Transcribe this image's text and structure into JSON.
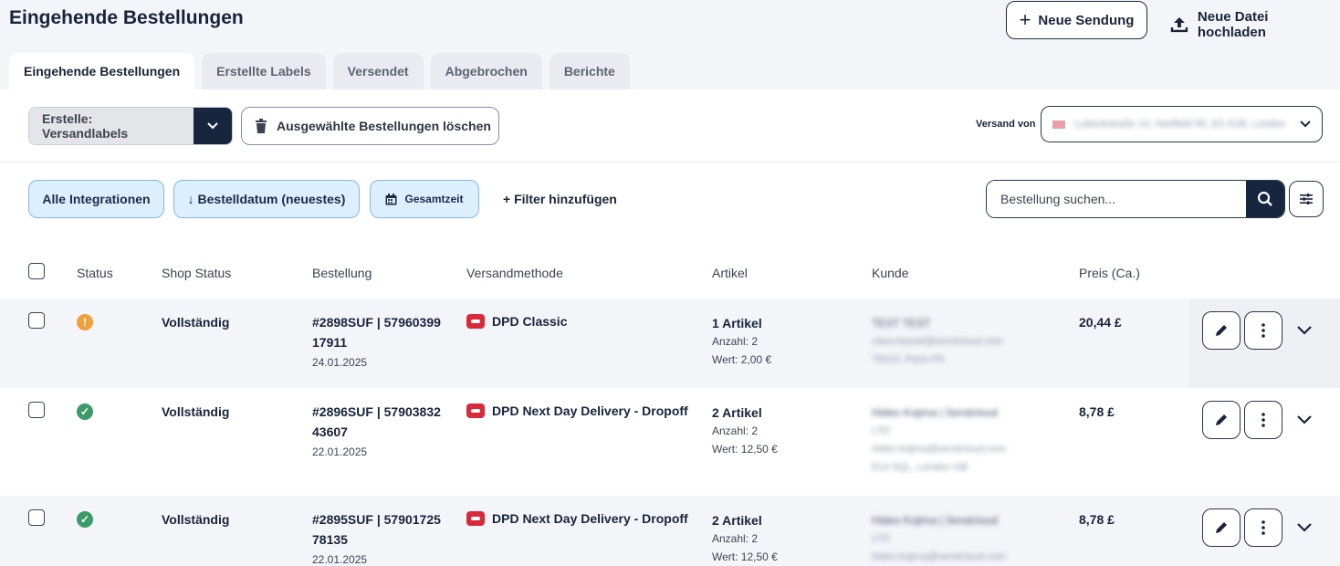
{
  "header": {
    "title": "Eingehende Bestellungen",
    "new_shipment_label": "Neue Sendung",
    "upload_label": "Neue Datei hochladen"
  },
  "tabs": [
    {
      "label": "Eingehende Bestellungen",
      "active": true
    },
    {
      "label": "Erstellte Labels",
      "active": false
    },
    {
      "label": "Versendet",
      "active": false
    },
    {
      "label": "Abgebrochen",
      "active": false
    },
    {
      "label": "Berichte",
      "active": false
    }
  ],
  "toolbar": {
    "create_label": "Erstelle: Versandlabels",
    "delete_label": "Ausgewählte Bestellungen löschen",
    "ship_from_label": "Versand von",
    "ship_from_value": "Lubeckstraße 14, Hartfield 95, E9 2UB, London"
  },
  "filters": {
    "integrations": "Alle Integrationen",
    "sort": "↓ Bestelldatum (neuestes)",
    "period": "Gesamtzeit",
    "add_filter": "+ Filter hinzufügen",
    "search_placeholder": "Bestellung suchen..."
  },
  "columns": [
    "Status",
    "Shop Status",
    "Bestellung",
    "Versandmethode",
    "Artikel",
    "Kunde",
    "Preis (Ca.)"
  ],
  "orders": [
    {
      "status": "warning",
      "status_color": "#f0a03c",
      "shop_status": "Vollständig",
      "order_line1": "#2898SUF | 57960399",
      "order_line2": "17911",
      "date": "24.01.2025",
      "method": "DPD Classic",
      "items": "1 Artikel",
      "qty": "Anzahl: 2",
      "value": "Wert: 2,00 €",
      "customer_name": "TEST TEST",
      "customer_line2": "clara.hessel@sendcloud.com",
      "customer_line3": "75015, Paris FR",
      "price": "20,44 £"
    },
    {
      "status": "ok",
      "status_color": "#3a9a6a",
      "shop_status": "Vollständig",
      "order_line1": "#2896SUF | 57903832",
      "order_line2": "43607",
      "date": "22.01.2025",
      "method": "DPD Next Day Delivery - Dropoff",
      "items": "2 Artikel",
      "qty": "Anzahl: 2",
      "value": "Wert: 12,50 €",
      "customer_name": "Hideo Kojima | Sendcloud",
      "customer_line2": "LTD",
      "customer_line3": "hideo.kojima@sendcloud.com",
      "customer_line4": "E14 5QL, London GB",
      "price": "8,78 £"
    },
    {
      "status": "ok",
      "status_color": "#3a9a6a",
      "shop_status": "Vollständig",
      "order_line1": "#2895SUF | 57901725",
      "order_line2": "78135",
      "date": "22.01.2025",
      "method": "DPD Next Day Delivery - Dropoff",
      "items": "2 Artikel",
      "qty": "Anzahl: 2",
      "value": "Wert: 12,50 €",
      "customer_name": "Hideo Kojima | Sendcloud",
      "customer_line2": "LTD",
      "customer_line3": "hideo.kojima@sendcloud.com",
      "customer_line4": "",
      "price": "8,78 £"
    }
  ]
}
